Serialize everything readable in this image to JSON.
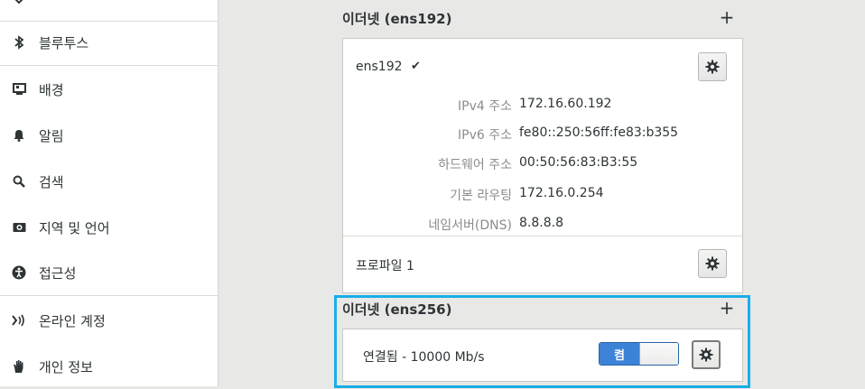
{
  "sidebar": {
    "items": [
      {
        "label": "블루투스",
        "icon": "bluetooth-icon"
      },
      {
        "label": "배경",
        "icon": "background-icon"
      },
      {
        "label": "알림",
        "icon": "bell-icon"
      },
      {
        "label": "검색",
        "icon": "search-icon"
      },
      {
        "label": "지역 및 언어",
        "icon": "region-icon"
      },
      {
        "label": "접근성",
        "icon": "accessibility-icon"
      },
      {
        "label": "온라인 계정",
        "icon": "online-accounts-icon"
      },
      {
        "label": "개인 정보",
        "icon": "privacy-hand-icon"
      }
    ]
  },
  "ethernet1": {
    "title": "이더넷 (ens192)",
    "device_name": "ens192",
    "connected_mark": "✔",
    "details": [
      {
        "key": "IPv4 주소",
        "value": "172.16.60.192"
      },
      {
        "key": "IPv6 주소",
        "value": "fe80::250:56ff:fe83:b355"
      },
      {
        "key": "하드웨어 주소",
        "value": "00:50:56:83:B3:55"
      },
      {
        "key": "기본 라우팅",
        "value": "172.16.0.254"
      },
      {
        "key": "네임서버(DNS)",
        "value": "8.8.8.8"
      }
    ],
    "profile_label": "프로파일 1"
  },
  "ethernet2": {
    "title": "이더넷 (ens256)",
    "status": "연결됨 - 10000 Mb/s",
    "toggle_label": "켬",
    "toggle_state": "on"
  },
  "colors": {
    "accent": "#3c82d6",
    "focus": "#1aaee6"
  }
}
